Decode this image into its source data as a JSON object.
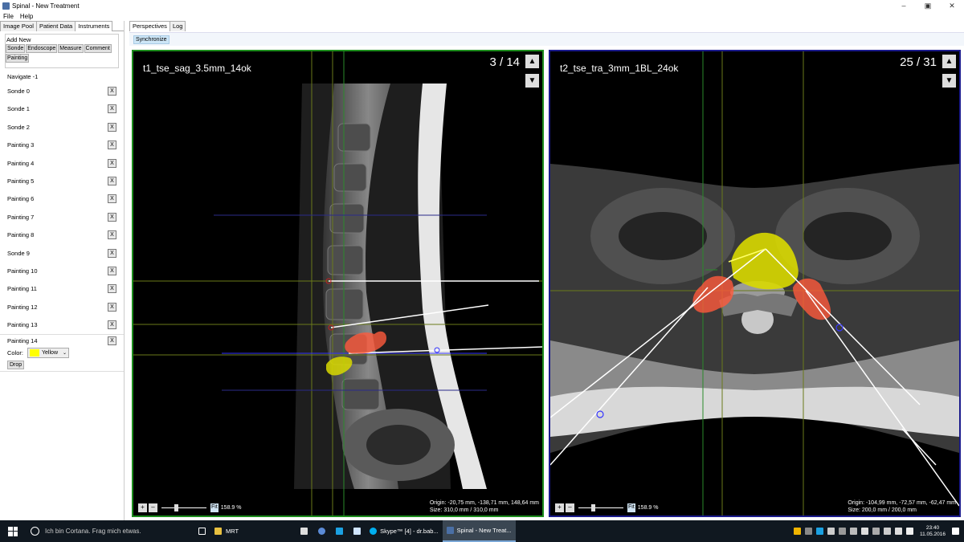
{
  "window": {
    "title": "Spinal - New Treatment"
  },
  "menu": [
    "File",
    "Help"
  ],
  "left_tabs": [
    "Image Pool",
    "Patient Data",
    "Instruments"
  ],
  "add_new": {
    "label": "Add New",
    "buttons": [
      "Sonde",
      "Endoscope",
      "Measure",
      "Comment",
      "Painting"
    ]
  },
  "navigate": "Navigate -1",
  "instruments": [
    "Sonde 0",
    "Sonde 1",
    "Sonde 2",
    "Painting 3",
    "Painting 4",
    "Painting 5",
    "Painting 6",
    "Painting 7",
    "Painting 8",
    "Sonde 9",
    "Painting 10",
    "Painting 11",
    "Painting 12",
    "Painting 13"
  ],
  "remove_label": "X",
  "selected_instrument": {
    "name": "Painting 14",
    "color_label": "Color:",
    "color_value": "Yellow",
    "drop_label": "Drop"
  },
  "right_tabs": [
    "Perspectives",
    "Log"
  ],
  "sync_label": "Synchronize",
  "viewports": [
    {
      "name": "t1_tse_sag_3.5mm_14ok",
      "slice": "3 / 14",
      "zoom": "158.9 %",
      "fit": "Fit",
      "origin": "Origin: -20,75 mm, -138,71 mm, 148,64 mm",
      "size": "Size: 310,0 mm / 310,0 mm",
      "border_color": "#1c8c1c"
    },
    {
      "name": "t2_tse_tra_3mm_1BL_24ok",
      "slice": "25 / 31",
      "zoom": "158.9 %",
      "fit": "Fit",
      "origin": "Origin: -104,99 mm, -72,57 mm, -62,47 mm",
      "size": "Size: 200,0 mm / 200,0 mm",
      "border_color": "#1b1b8c"
    }
  ],
  "taskbar": {
    "search_placeholder": "Ich bin Cortana. Frag mich etwas.",
    "apps": [
      "MRT",
      "Skype™ [4] - dr.bab...",
      "Spinal - New Treat..."
    ],
    "time": "23:40",
    "date": "11.05.2016"
  },
  "colors": {
    "accent": "#0078d7",
    "painting_yellow": "#ffff00",
    "painting_red": "#ff5a3c"
  }
}
